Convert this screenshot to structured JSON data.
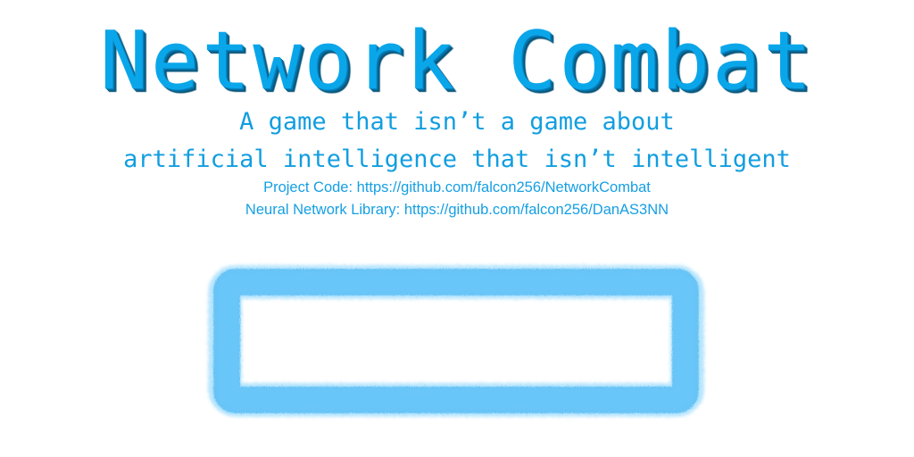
{
  "title": "Network Combat",
  "subtitle_line1": "A game that isn’t a game about",
  "subtitle_line2": "artificial intelligence that isn’t intelligent",
  "links": {
    "project_code": "Project Code: https://github.com/falcon256/NetworkCombat",
    "neural_network_library": "Neural Network Library: https://github.com/falcon256/DanAS3NN"
  },
  "colors": {
    "title": "#0aa6ea",
    "subtitle": "#129ee0",
    "frame": "#5ec3f8"
  }
}
